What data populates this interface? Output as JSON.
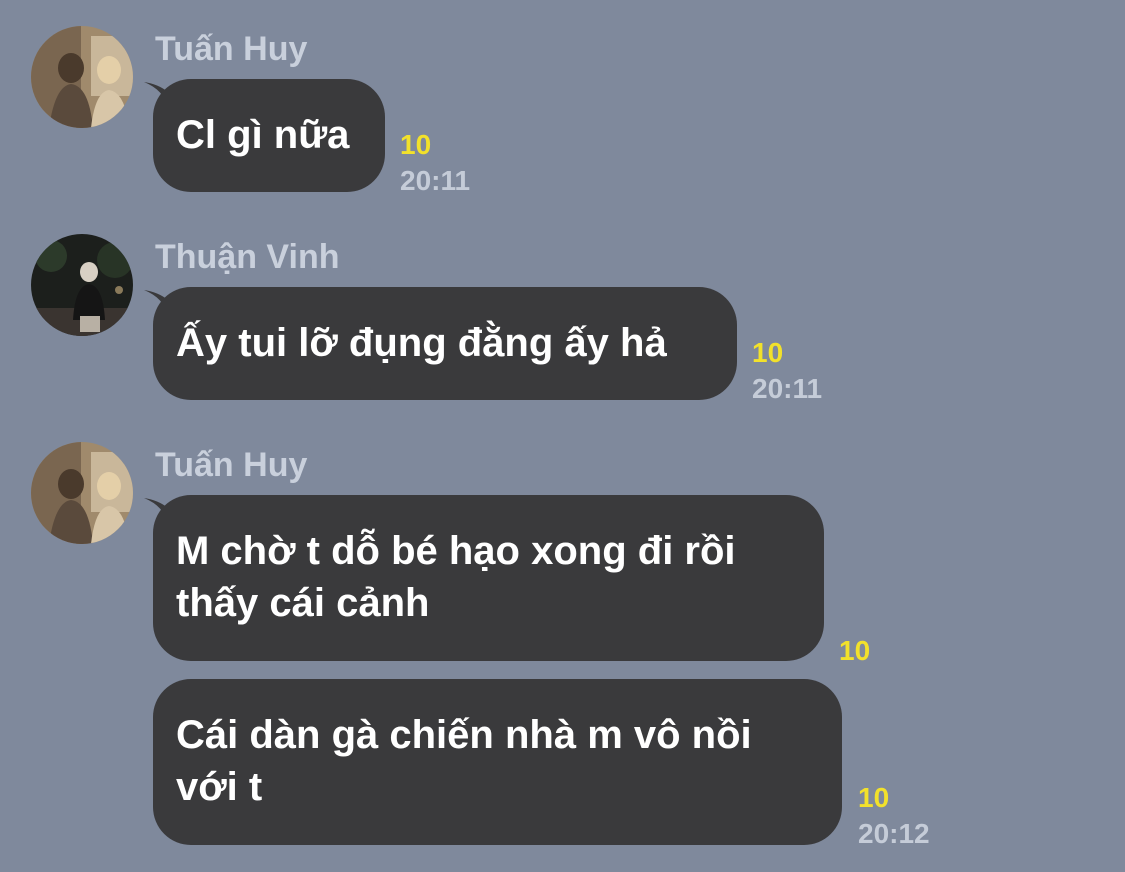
{
  "messages": [
    {
      "sender": "Tuấn Huy",
      "avatar": "tuan-huy-photo",
      "bubbles": [
        {
          "text": "Cl gì nữa",
          "read": "10",
          "time": "20:11"
        }
      ]
    },
    {
      "sender": "Thuận Vinh",
      "avatar": "thuan-vinh-photo",
      "bubbles": [
        {
          "text": "Ấy tui lỡ đụng đằng ấy hả",
          "read": "10",
          "time": "20:11"
        }
      ]
    },
    {
      "sender": "Tuấn Huy",
      "avatar": "tuan-huy-photo",
      "bubbles": [
        {
          "line1": "M chờ t dỗ bé hạo xong đi rồi",
          "line2": "thấy cái cảnh",
          "read": "10"
        },
        {
          "line1": "Cái dàn gà chiến nhà m vô nồi",
          "line2": "với t",
          "read": "10",
          "time": "20:12"
        }
      ]
    }
  ],
  "colors": {
    "background": "#7f899c",
    "bubble": "#3a3a3c",
    "bubble_text": "#ffffff",
    "read_count": "#f2e12b",
    "timestamp": "#c5ccd8",
    "sender_name": "#c9d0dc"
  }
}
